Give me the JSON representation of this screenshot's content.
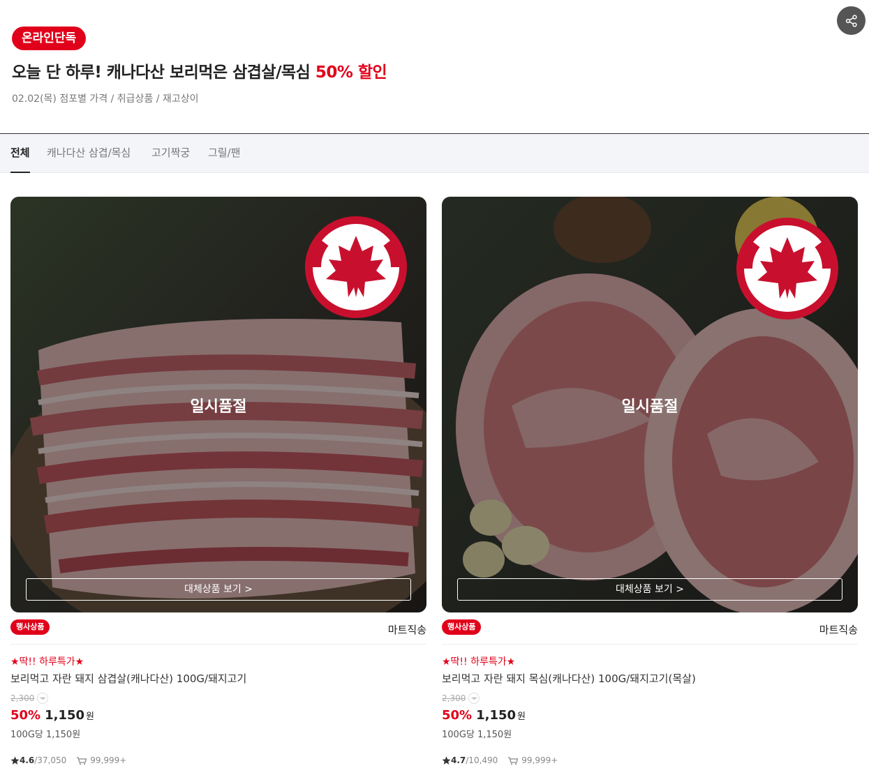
{
  "header": {
    "badge": "온라인단독",
    "title_main": "오늘 단 하루! 캐나다산 보리먹은 삼겹살/목심 ",
    "title_accent": "50% 할인",
    "subtitle": "02.02(목) 점포별 가격 / 취급상품 / 재고상이",
    "share_icon": "share-icon"
  },
  "tabs": [
    {
      "label": "전체",
      "active": true
    },
    {
      "label": "캐나다산 삼겹/목심",
      "active": false
    },
    {
      "label": "고기짝궁",
      "active": false
    },
    {
      "label": "그릴/팬",
      "active": false
    }
  ],
  "products": [
    {
      "soldout": "일시품절",
      "alt_button": "대체상품 보기 >",
      "event_badge": "행사상품",
      "delivery": "마트직송",
      "promo": "★딱!! 하루특가★",
      "name": "보리먹고 자란 돼지 삼겹살(캐나다산) 100G/돼지고기",
      "original_price": "2,300",
      "discount_rate": "50%",
      "price": "1,150",
      "currency": "원",
      "unit_price": "100G당 1,150원",
      "rating": "4.6",
      "review_count": "/37,050",
      "cart_count": "99,999+"
    },
    {
      "soldout": "일시품절",
      "alt_button": "대체상품 보기 >",
      "event_badge": "행사상품",
      "delivery": "마트직송",
      "promo": "★딱!! 하루특가★",
      "name": "보리먹고 자란 돼지 목심(캐나다산) 100G/돼지고기(목살)",
      "original_price": "2,300",
      "discount_rate": "50%",
      "price": "1,150",
      "currency": "원",
      "unit_price": "100G당 1,150원",
      "rating": "4.7",
      "review_count": "/10,490",
      "cart_count": "99,999+"
    }
  ],
  "colors": {
    "accent": "#e1001a",
    "text": "#222222",
    "muted": "#888888"
  }
}
